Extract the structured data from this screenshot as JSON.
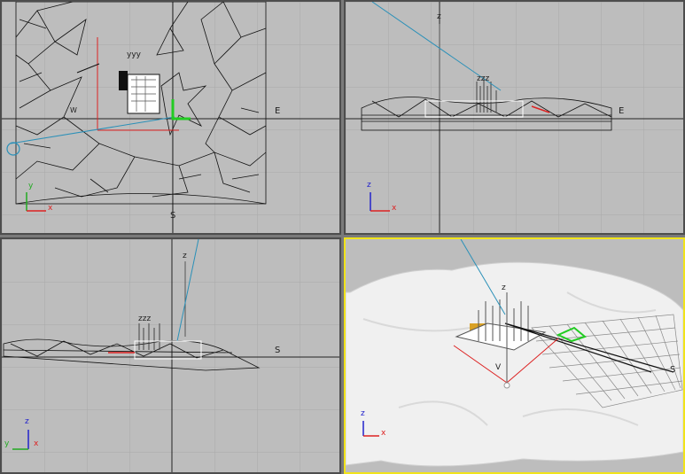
{
  "viewports": [
    {
      "name": "top",
      "active": false,
      "compass": [
        "E",
        "S"
      ],
      "gizmo": [
        "y",
        "x"
      ]
    },
    {
      "name": "front",
      "active": false,
      "compass": [
        "E"
      ],
      "gizmo": [
        "z",
        "x"
      ]
    },
    {
      "name": "left",
      "active": false,
      "compass": [
        "S"
      ],
      "gizmo": [
        "z",
        "y",
        "x"
      ]
    },
    {
      "name": "perspective",
      "active": true,
      "compass": [
        "S"
      ],
      "gizmo": [
        "z",
        "x"
      ]
    }
  ],
  "labels": {
    "top": {
      "e": "E",
      "s": "S",
      "w": "W",
      "gx": "x",
      "gy": "y",
      "yyy": "yyy"
    },
    "front": {
      "e": "E",
      "z": "z",
      "gz": "z",
      "gx": "x",
      "zzz": "zzz"
    },
    "left": {
      "s": "S",
      "z": "z",
      "gz": "z",
      "gy": "y",
      "gx": "x",
      "zzz": "zzz"
    },
    "persp": {
      "s": "S",
      "z": "z",
      "v": "V",
      "gz": "z",
      "gx": "x"
    }
  },
  "colors": {
    "active_border": "#f1e31a",
    "viewport_bg": "#bdbdbd",
    "axis_x": "#d22",
    "axis_y": "#2a2",
    "axis_z": "#22c"
  }
}
